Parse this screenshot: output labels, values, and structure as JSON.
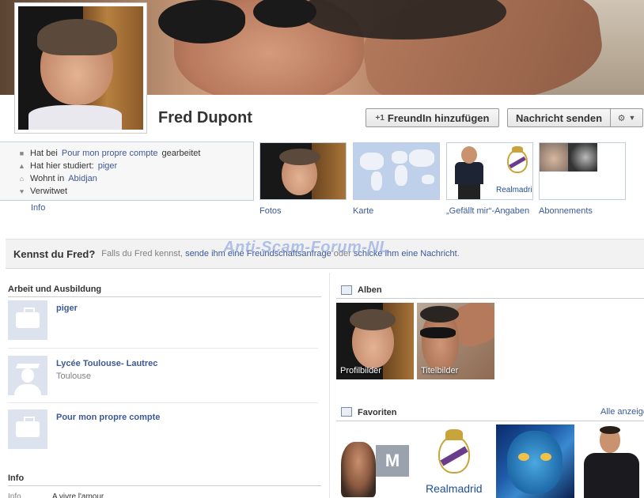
{
  "profile": {
    "name": "Fred Dupont",
    "buttons": {
      "add_friend": "FreundIn hinzufügen",
      "send_message": "Nachricht senden"
    }
  },
  "info": {
    "lines": [
      {
        "icon": "briefcase-icon",
        "prefix": "Hat bei ",
        "link": "Pour mon propre compte",
        "suffix": " gearbeitet"
      },
      {
        "icon": "graduation-cap-icon",
        "prefix": "Hat hier studiert: ",
        "link": "piger",
        "suffix": ""
      },
      {
        "icon": "house-icon",
        "prefix": "Wohnt in ",
        "link": "Abidjan",
        "suffix": ""
      },
      {
        "icon": "heart-icon",
        "prefix": "Verwitwet",
        "link": "",
        "suffix": ""
      }
    ],
    "tab_label": "Info"
  },
  "thumbnails": [
    {
      "label": "Fotos"
    },
    {
      "label": "Karte"
    },
    {
      "label": "„Gefällt mir“-Angaben"
    },
    {
      "label": "Abonnements"
    }
  ],
  "watermark": "Anti-Scam-Forum-NL",
  "kennst": {
    "title": "Kennst du Fred?",
    "text_prefix": "Falls du Fred kennst, ",
    "link1": "sende ihm eine Freundschaftsanfrage",
    "text_middle": " oder ",
    "link2": "schicke ihm eine Nachricht",
    "text_suffix": "."
  },
  "work": {
    "heading": "Arbeit und Ausbildung",
    "entries": [
      {
        "title": "piger",
        "subtitle": "",
        "icon": "briefcase-icon"
      },
      {
        "title": "Lycée Toulouse- Lautrec",
        "subtitle": "Toulouse",
        "icon": "graduation-cap-icon"
      },
      {
        "title": "Pour mon propre compte",
        "subtitle": "",
        "icon": "briefcase-icon"
      }
    ]
  },
  "info_section": {
    "heading": "Info",
    "partial_label": "Info",
    "partial_value": "A vivre l'amour"
  },
  "albums": {
    "heading": "Alben",
    "items": [
      {
        "caption": "Profilbilder"
      },
      {
        "caption": "Titelbilder"
      }
    ]
  },
  "favorites": {
    "heading": "Favoriten",
    "show_all": "Alle anzeige"
  },
  "logos": {
    "realmadrid": "Realmadrid",
    "mtv": "M"
  },
  "colors": {
    "link": "#3b5998",
    "border": "#c4cde0"
  }
}
